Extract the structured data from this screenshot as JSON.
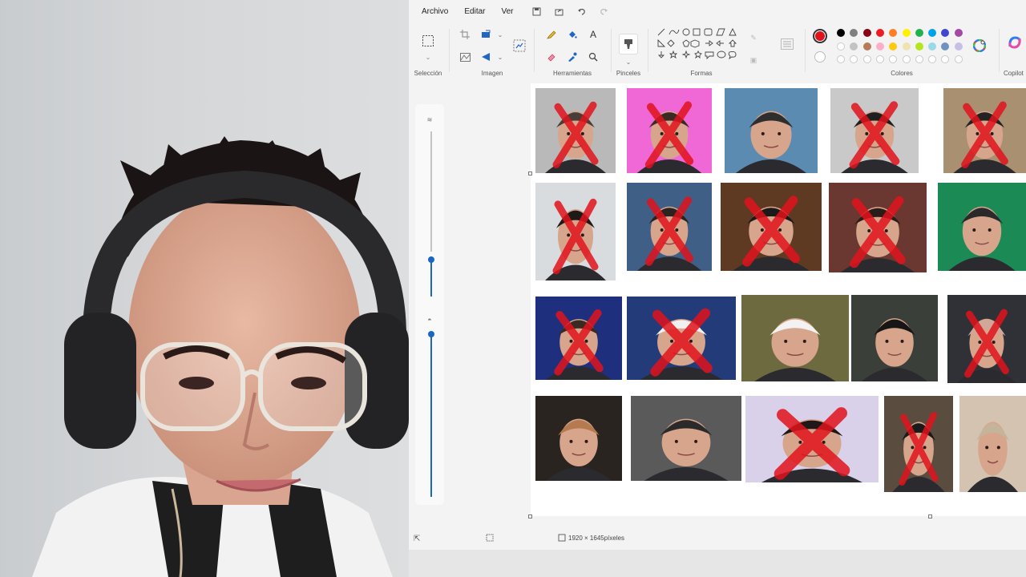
{
  "menu": {
    "archivo": "Archivo",
    "editar": "Editar",
    "ver": "Ver"
  },
  "ribbon": {
    "groups": {
      "seleccion": "Selección",
      "imagen": "Imagen",
      "herramientas": "Herramientas",
      "pinceles": "Pinceles",
      "formas": "Formas",
      "colores": "Colores",
      "copilot": "Copilot"
    },
    "colors": {
      "primary": "#e0131c",
      "palette_row1": [
        "#000000",
        "#7f7f7f",
        "#880015",
        "#ed1c24",
        "#ff7f27",
        "#fff200",
        "#22b14c",
        "#00a2e8",
        "#3f48cc",
        "#a349a4"
      ],
      "palette_row2": [
        "#ffffff",
        "#c3c3c3",
        "#b97a57",
        "#ffaec9",
        "#ffc90e",
        "#efe4b0",
        "#b5e61d",
        "#99d9ea",
        "#7092be",
        "#c8bfe7"
      ]
    }
  },
  "canvas": {
    "dimensions_text": "1920 × 1645píxeles",
    "x_mark_color": "#e0131c"
  }
}
